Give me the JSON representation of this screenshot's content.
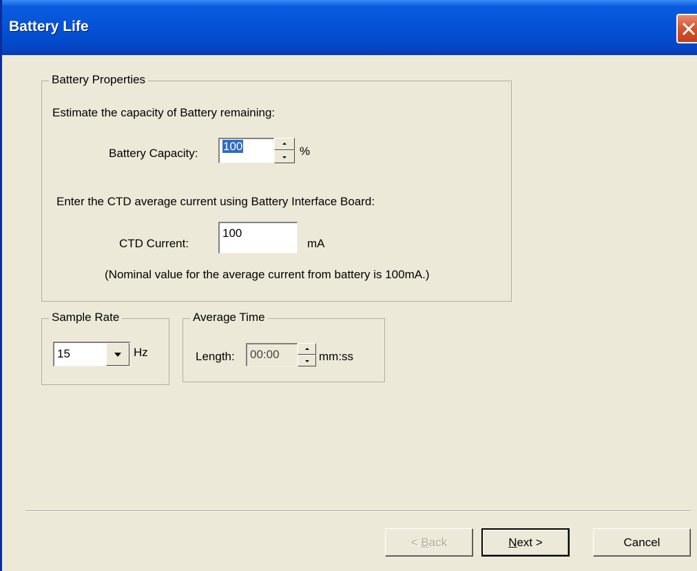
{
  "window": {
    "title": "Battery Life"
  },
  "battery_properties": {
    "group_label": "Battery Properties",
    "estimate_text": "Estimate the capacity of Battery remaining:",
    "capacity_label": "Battery Capacity:",
    "capacity_value": "100",
    "capacity_unit": "%",
    "ctd_instruction": "Enter the CTD average current using Battery Interface Board:",
    "ctd_label": "CTD Current:",
    "ctd_value": "100",
    "ctd_unit": "mA",
    "nominal_note": "(Nominal value for the average current from battery is 100mA.)"
  },
  "sample_rate": {
    "group_label": "Sample Rate",
    "value": "15",
    "unit": "Hz"
  },
  "average_time": {
    "group_label": "Average Time",
    "length_label": "Length:",
    "value": "00:00",
    "unit": "mm:ss"
  },
  "buttons": {
    "back_prefix": "< ",
    "back_mnemonic": "B",
    "back_rest": "ack",
    "next_mnemonic": "N",
    "next_rest": "ext >",
    "cancel": "Cancel"
  },
  "icons": {
    "close": "close-icon",
    "spin_up": "arrow-up-icon",
    "spin_down": "arrow-down-icon",
    "dropdown": "chevron-down-icon"
  },
  "colors": {
    "titlebar": "#0453D6",
    "dialog_bg": "#ECE9D8",
    "selection": "#316AC5",
    "close": "#D5532E"
  }
}
